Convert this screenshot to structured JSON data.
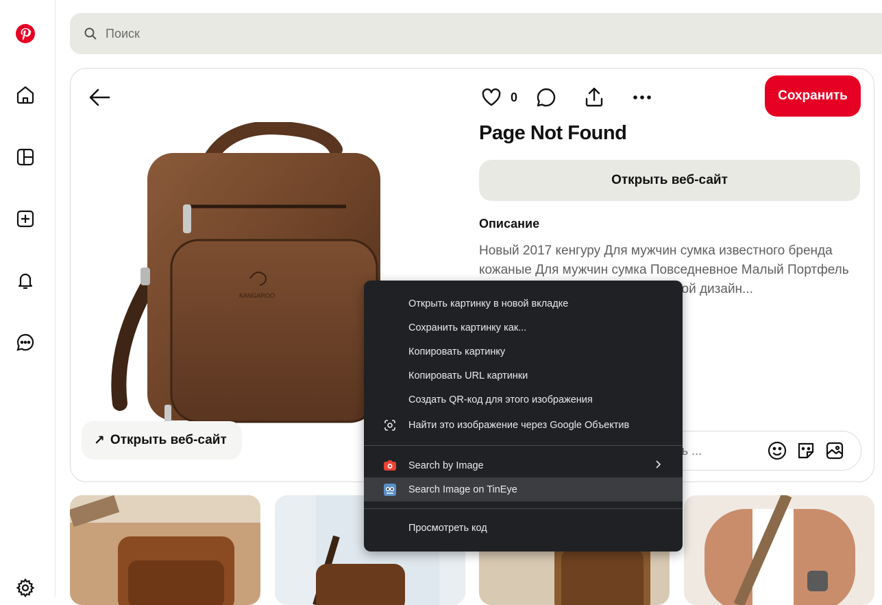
{
  "search": {
    "placeholder": "Поиск"
  },
  "sidebar": {
    "items": [
      {
        "icon": "home-icon"
      },
      {
        "icon": "boards-icon"
      },
      {
        "icon": "create-icon"
      },
      {
        "icon": "notifications-icon"
      },
      {
        "icon": "messages-icon"
      },
      {
        "icon": "settings-icon"
      }
    ]
  },
  "pin": {
    "like_count": "0",
    "save_label": "Сохранить",
    "title": "Page Not Found",
    "open_site_label": "Открыть веб-сайт",
    "image_open_site_label": "Открыть веб-сайт",
    "description_heading": "Описание",
    "description_text": "Новый 2017 кенгуру Для мужчин сумка известного бренда кожаные Для мужчин сумка Повседневное Малый Портфель Crossbody сумки на ремне Мужской дизайн...",
    "comment_placeholder": "ы начать ..."
  },
  "context_menu": {
    "items": [
      "Открыть картинку в новой вкладке",
      "Сохранить картинку как...",
      "Копировать картинку",
      "Копировать URL картинки",
      "Создать QR-код для этого изображения",
      "Найти это изображение через Google Объектив"
    ],
    "extension_items": [
      "Search by Image",
      "Search Image on TinEye"
    ],
    "inspect_label": "Просмотреть код"
  },
  "colors": {
    "brand_red": "#e60023",
    "menu_bg": "#202124"
  }
}
